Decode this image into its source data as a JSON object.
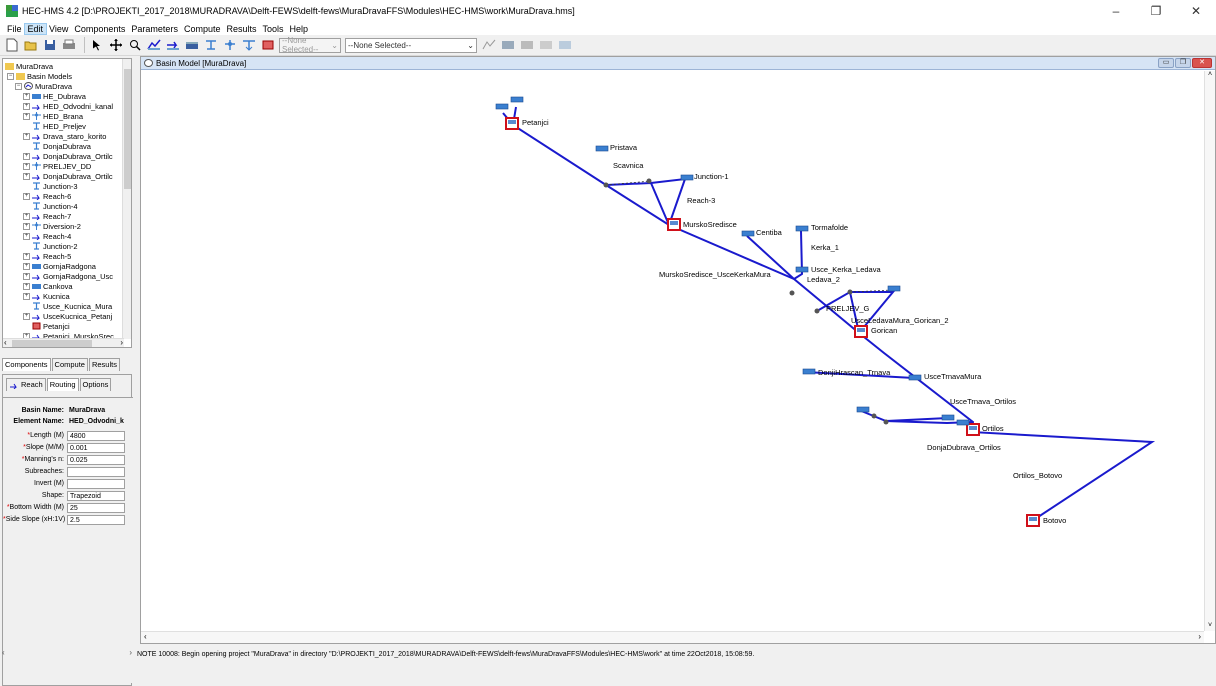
{
  "window": {
    "title": "HEC-HMS 4.2 [D:\\PROJEKTI_2017_2018\\MURADRAVA\\Delft-FEWS\\delft-fews\\MuraDravaFFS\\Modules\\HEC-HMS\\work\\MuraDrava.hms]",
    "minimize": "–",
    "maximize": "❐",
    "close": "✕"
  },
  "menu": [
    "File",
    "Edit",
    "View",
    "Components",
    "Parameters",
    "Compute",
    "Results",
    "Tools",
    "Help"
  ],
  "toolbar": {
    "select1": "--None Selected--",
    "select2": "--None Selected--"
  },
  "tree": {
    "root": "MuraDrava",
    "basin_models": "Basin Models",
    "basin": "MuraDrava",
    "items": [
      {
        "label": "HE_Dubrava",
        "kind": "reservoir"
      },
      {
        "label": "HED_Odvodni_kanal",
        "kind": "reach"
      },
      {
        "label": "HED_Brana",
        "kind": "diversion"
      },
      {
        "label": "HED_Preljev",
        "kind": "junction"
      },
      {
        "label": "Drava_staro_korito",
        "kind": "reach"
      },
      {
        "label": "DonjaDubrava",
        "kind": "junction"
      },
      {
        "label": "DonjaDubrava_Ortilc",
        "kind": "reach"
      },
      {
        "label": "PRELJEV_DD",
        "kind": "diversion"
      },
      {
        "label": "DonjaDubrava_Ortilc",
        "kind": "reach"
      },
      {
        "label": "Junction-3",
        "kind": "junction"
      },
      {
        "label": "Reach-6",
        "kind": "reach"
      },
      {
        "label": "Junction-4",
        "kind": "junction"
      },
      {
        "label": "Reach-7",
        "kind": "reach"
      },
      {
        "label": "Diversion-2",
        "kind": "diversion"
      },
      {
        "label": "Reach-4",
        "kind": "reach"
      },
      {
        "label": "Junction-2",
        "kind": "junction"
      },
      {
        "label": "Reach-5",
        "kind": "reach"
      },
      {
        "label": "GornjaRadgona",
        "kind": "reservoir"
      },
      {
        "label": "GornjaRadgona_Usc",
        "kind": "reach"
      },
      {
        "label": "Cankova",
        "kind": "reservoir"
      },
      {
        "label": "Kucnica",
        "kind": "reach"
      },
      {
        "label": "Usce_Kucnica_Mura",
        "kind": "junction"
      },
      {
        "label": "UsceKucnica_Petanj",
        "kind": "reach"
      },
      {
        "label": "Petanjci",
        "kind": "sink"
      },
      {
        "label": "Petanjci_MurskoSrec",
        "kind": "reach"
      }
    ]
  },
  "tabs_main": [
    "Components",
    "Compute",
    "Results"
  ],
  "tabs_editor": [
    "Reach",
    "Routing",
    "Options"
  ],
  "editor": {
    "basin_name_label": "Basin Name:",
    "basin_name": "MuraDrava",
    "element_name_label": "Element Name:",
    "element_name": "HED_Odvodni_k",
    "fields": [
      {
        "label": "Length (M)",
        "required": true,
        "value": "4800"
      },
      {
        "label": "Slope (M/M)",
        "required": true,
        "value": "0.001"
      },
      {
        "label": "Manning's n:",
        "required": true,
        "value": "0.025"
      },
      {
        "label": "Subreaches:",
        "required": false,
        "value": ""
      },
      {
        "label": "Invert (M)",
        "required": false,
        "value": ""
      },
      {
        "label": "Shape:",
        "required": false,
        "value": "Trapezoid"
      },
      {
        "label": "Bottom Width (M)",
        "required": true,
        "value": "25"
      },
      {
        "label": "Side Slope (xH:1V)",
        "required": true,
        "value": "2.5"
      }
    ]
  },
  "canvas": {
    "title": "Basin Model [MuraDrava]",
    "labels": {
      "petanjci": "Petanjci",
      "pristava": "Pristava",
      "scavnica": "Scavnica",
      "junction1": "Junction-1",
      "reach3": "Reach-3",
      "murskosredisce": "MurskoSredisce",
      "centiba": "Centiba",
      "tormafolde": "Tormafolde",
      "kerka1": "Kerka_1",
      "usce_kerka": "Usce_Kerka_Ledava",
      "ledava2": "Ledava_2",
      "ms_usce": "MurskoSredisce_UsceKerkaMura",
      "preljev_g": "PRELJEV_G",
      "usce_ledava": "UsceLedavaMura_Gorican_2",
      "gorican": "Gorican",
      "donji_hrascan": "DonjiHrascan_Trnava",
      "usce_trnava": "UsceTrnavaMura",
      "usce_trnava_ortilos": "UsceTrnava_Ortilos",
      "ortilos": "Ortilos",
      "dd_ortilos": "DonjaDubrava_Ortilos",
      "ortilos_botovo": "Ortilos_Botovo",
      "botovo": "Botovo"
    }
  },
  "status": "NOTE 10008:  Begin opening project \"MuraDrava\" in directory \"D:\\PROJEKTI_2017_2018\\MURADRAVA\\Delft-FEWS\\delft-fews\\MuraDravaFFS\\Modules\\HEC-HMS\\work\" at time 22Oct2018, 15:08:59.",
  "colors": {
    "reach": "#1a1acd",
    "sink": "#d0101a",
    "junction": "#3a7fd0",
    "titlebar_canvas": "#d6e4f5"
  }
}
